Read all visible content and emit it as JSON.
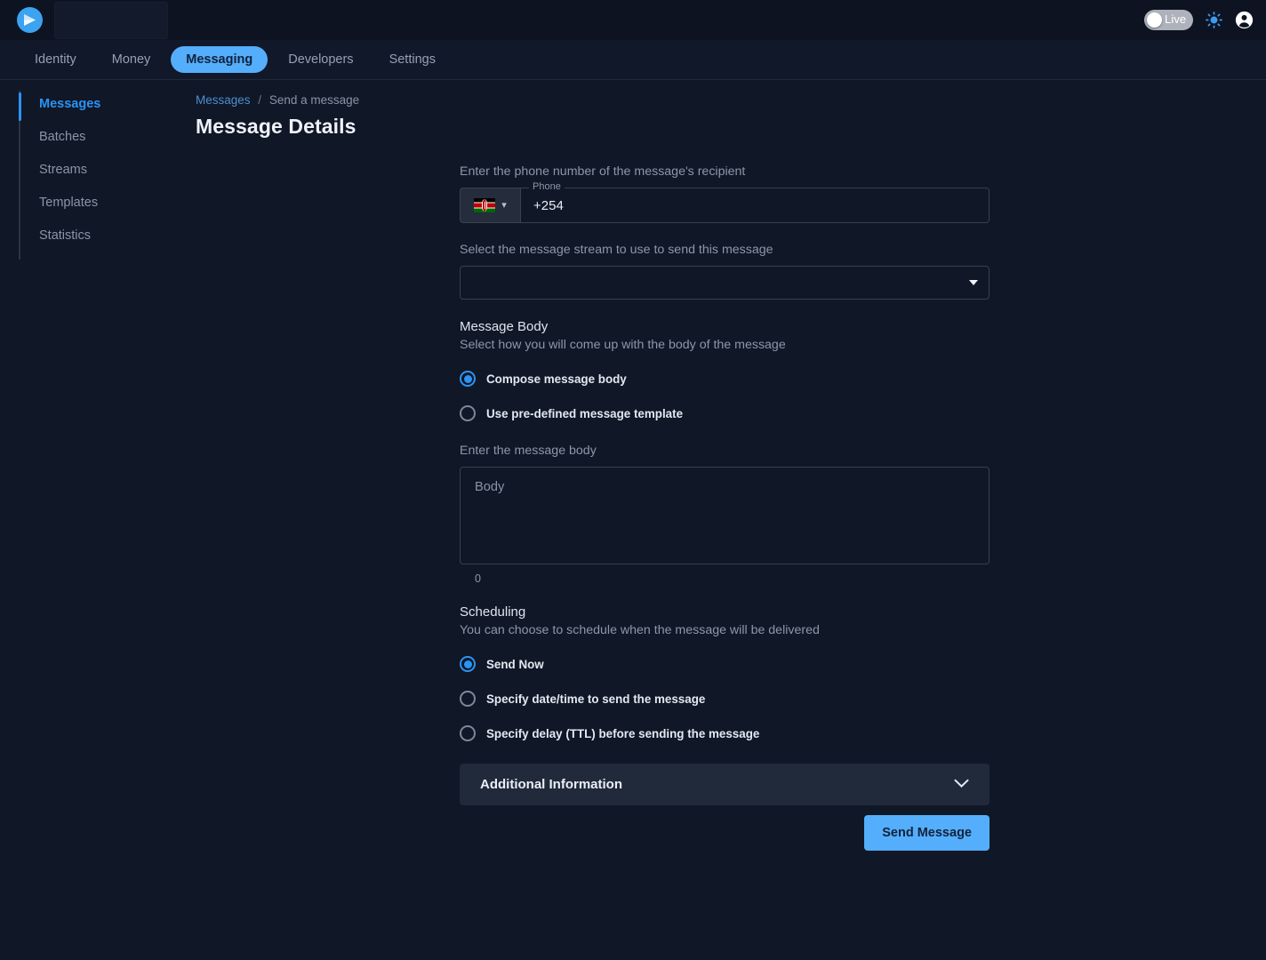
{
  "colors": {
    "page_bg": "#101726",
    "topbar_bg": "#0d1320",
    "nav_bg": "#111829",
    "accent_blue": "#54aefb",
    "link_blue": "#2b93f5",
    "panel_bg": "#212a3b",
    "border": "#39414f",
    "muted_text": "#8d97aa"
  },
  "topbar": {
    "logo_icon": "paper-plane-logo-icon",
    "live_toggle_label": "Live",
    "live_toggle_state": "off",
    "brightness_icon": "sun-brightness-icon",
    "account_icon": "account-circle-icon"
  },
  "nav": {
    "tabs": [
      {
        "label": "Identity",
        "active": false
      },
      {
        "label": "Money",
        "active": false
      },
      {
        "label": "Messaging",
        "active": true
      },
      {
        "label": "Developers",
        "active": false
      },
      {
        "label": "Settings",
        "active": false
      }
    ]
  },
  "sidebar": {
    "items": [
      {
        "label": "Messages",
        "active": true
      },
      {
        "label": "Batches",
        "active": false
      },
      {
        "label": "Streams",
        "active": false
      },
      {
        "label": "Templates",
        "active": false
      },
      {
        "label": "Statistics",
        "active": false
      }
    ]
  },
  "breadcrumb": {
    "parent": "Messages",
    "separator": "/",
    "current": "Send a message"
  },
  "page": {
    "title": "Message Details"
  },
  "form": {
    "phone": {
      "description": "Enter the phone number of the message's recipient",
      "legend": "Phone",
      "country_flag_icon": "flag-kenya-icon",
      "country_chevron_icon": "chevron-down-icon",
      "value": "+254",
      "placeholder": "Phone"
    },
    "stream": {
      "description": "Select the message stream to use to send this message",
      "selected_value": "",
      "placeholder": "",
      "dropdown_icon": "triangle-down-icon"
    },
    "message_body": {
      "heading": "Message Body",
      "subtext": "Select how you will come up with the body of the message",
      "options": [
        {
          "label": "Compose message body",
          "checked": true
        },
        {
          "label": "Use pre-defined message template",
          "checked": false
        }
      ],
      "body_description": "Enter the message body",
      "body_value": "",
      "body_placeholder": "Body",
      "char_count": "0"
    },
    "scheduling": {
      "heading": "Scheduling",
      "subtext": "You can choose to schedule when the message will be delivered",
      "options": [
        {
          "label": "Send Now",
          "checked": true
        },
        {
          "label": "Specify date/time to send the message",
          "checked": false
        },
        {
          "label": "Specify delay (TTL) before sending the message",
          "checked": false
        }
      ]
    },
    "additional_information": {
      "title": "Additional Information",
      "expanded": false,
      "chevron_icon": "chevron-down-icon"
    },
    "submit": {
      "label": "Send Message"
    }
  }
}
